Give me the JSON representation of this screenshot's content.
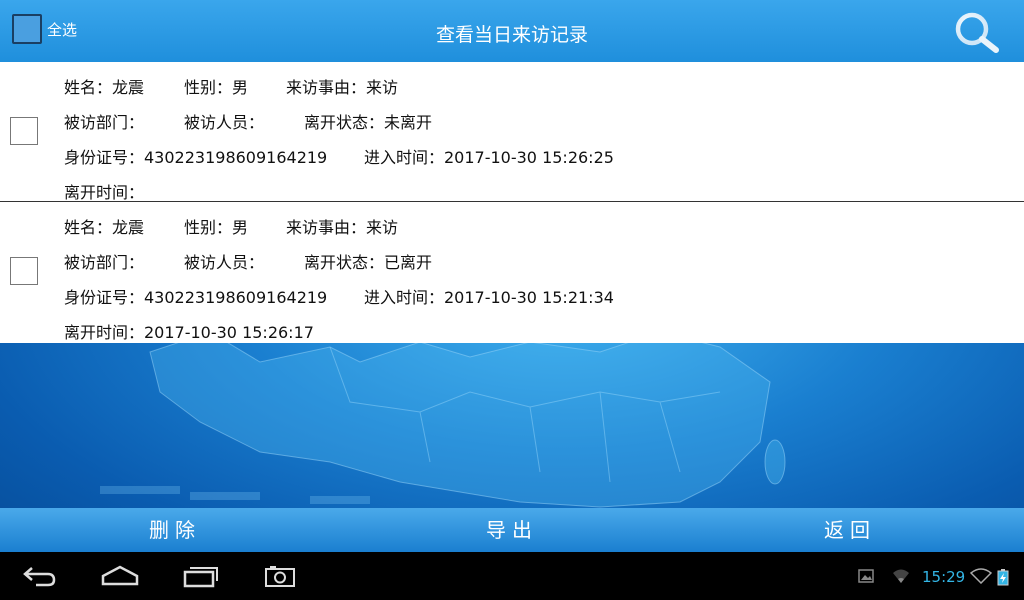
{
  "header": {
    "select_all_label": "全选",
    "title": "查看当日来访记录"
  },
  "records": [
    {
      "name": "姓名：龙震",
      "gender": "性别：男",
      "reason": "来访事由：来访",
      "department": "被访部门：",
      "staff": "被访人员：",
      "status": "离开状态：未离开",
      "id_number": "身份证号：430223198609164219",
      "entry_time": "进入时间：2017-10-30 15:26:25",
      "leave_time": "离开时间："
    },
    {
      "name": "姓名：龙震",
      "gender": "性别：男",
      "reason": "来访事由：来访",
      "department": "被访部门：",
      "staff": "被访人员：",
      "status": "离开状态：已离开",
      "id_number": "身份证号：430223198609164219",
      "entry_time": "进入时间：2017-10-30 15:21:34",
      "leave_time": "离开时间：2017-10-30 15:26:17"
    }
  ],
  "actions": {
    "delete": "删除",
    "export": "导出",
    "back": "返回"
  },
  "system_bar": {
    "clock": "15:29"
  },
  "colors": {
    "header": "#1f8fdc",
    "clock": "#33b5e5"
  }
}
